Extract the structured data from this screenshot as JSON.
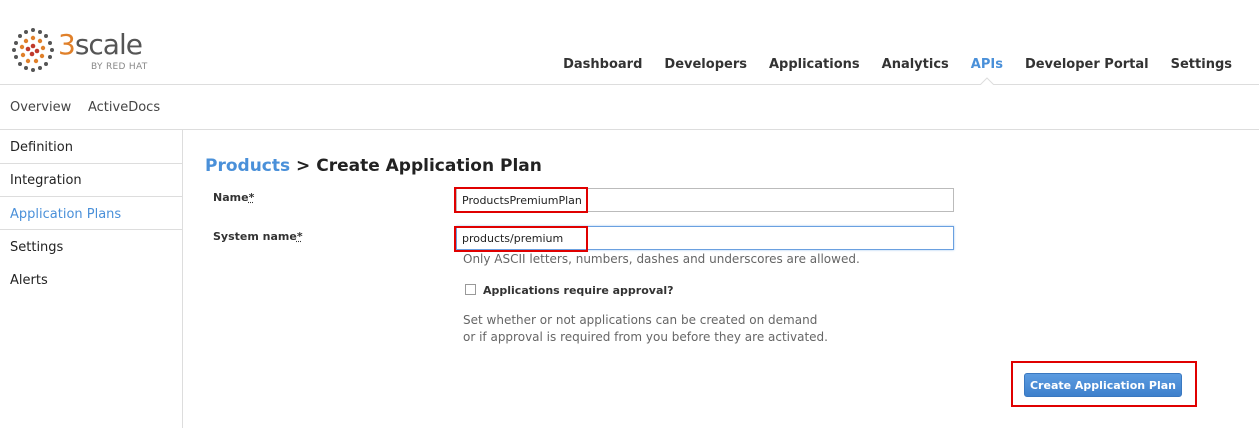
{
  "logo": {
    "three": "3",
    "word": "scale",
    "sub": "BY RED HAT"
  },
  "topnav": [
    {
      "label": "Dashboard",
      "active": false
    },
    {
      "label": "Developers",
      "active": false
    },
    {
      "label": "Applications",
      "active": false
    },
    {
      "label": "Analytics",
      "active": false
    },
    {
      "label": "APIs",
      "active": true
    },
    {
      "label": "Developer Portal",
      "active": false
    },
    {
      "label": "Settings",
      "active": false
    }
  ],
  "subnav": [
    "Overview",
    "ActiveDocs"
  ],
  "sidebar": [
    {
      "label": "Definition",
      "active": false
    },
    {
      "label": "Integration",
      "active": false
    },
    {
      "label": "Application Plans",
      "active": true
    },
    {
      "label": "Settings",
      "active": false
    },
    {
      "label": "Alerts",
      "active": false
    }
  ],
  "title": {
    "crumb": "Products",
    "separator": " > ",
    "page": "Create Application Plan"
  },
  "form": {
    "name_label": "Name",
    "name_required": "*",
    "name_value": "ProductsPremiumPlan",
    "system_label": "System name",
    "system_required": "*",
    "system_value": "products/premium",
    "system_hint": "Only ASCII letters, numbers, dashes and underscores are allowed.",
    "approval_label": "Applications require approval?",
    "approval_checked": false,
    "approval_hint_1": "Set whether or not applications can be created on demand",
    "approval_hint_2": "or if approval is required from you before they are activated.",
    "submit_label": "Create Application Plan"
  },
  "colors": {
    "accent": "#4a90d9",
    "highlight": "#e00000",
    "logo_orange": "#e0802a"
  }
}
